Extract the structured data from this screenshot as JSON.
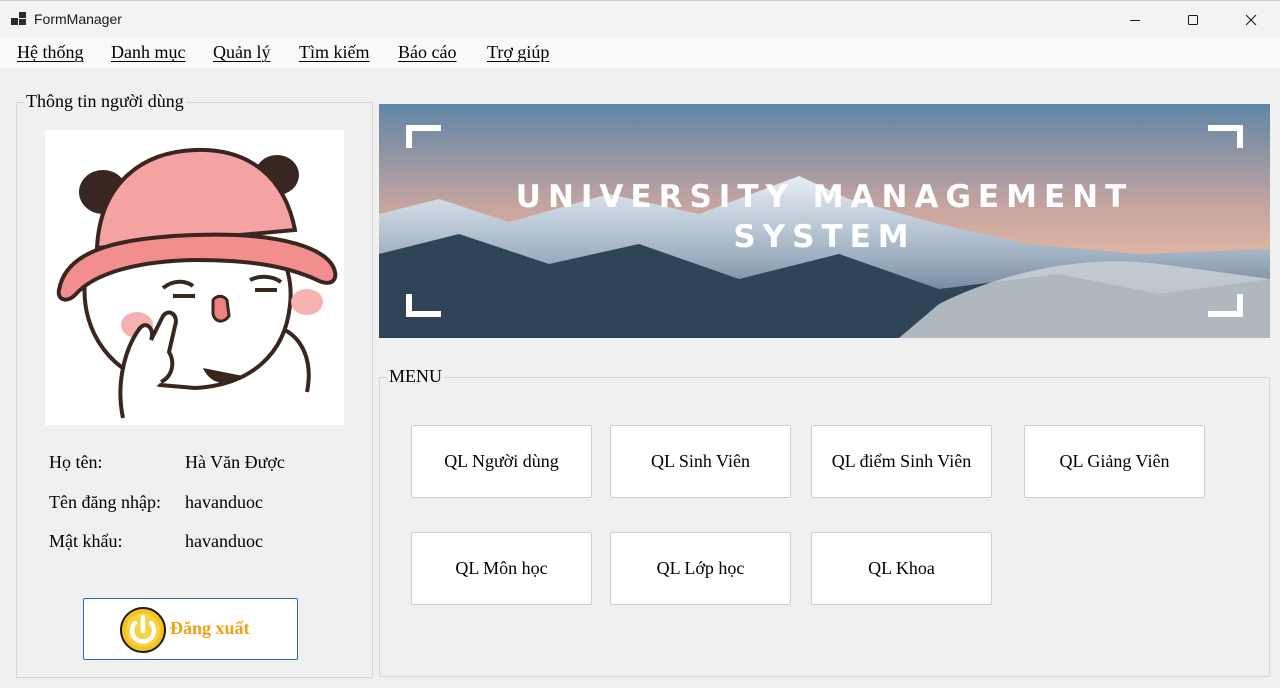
{
  "window": {
    "title": "FormManager",
    "icon": "app-windows-icon",
    "controls": [
      "minimize-icon",
      "maximize-icon",
      "close-icon"
    ]
  },
  "menubar": {
    "items": [
      {
        "label": "Hệ thống"
      },
      {
        "label": "Danh mục"
      },
      {
        "label": "Quản lý"
      },
      {
        "label": "Tìm kiếm"
      },
      {
        "label": "Báo cáo"
      },
      {
        "label": "Trợ giúp"
      }
    ]
  },
  "user_panel": {
    "legend": "Thông tin người dùng",
    "avatar_icon": "cartoon-avatar-pink-hat",
    "fields": [
      {
        "label": "Họ tên:",
        "value": "Hà Văn Được"
      },
      {
        "label": "Tên đăng nhập:",
        "value": "havanduoc"
      },
      {
        "label": "Mật khẩu:",
        "value": "havanduoc"
      }
    ],
    "logout": {
      "label": "Đăng xuất",
      "icon": "power-icon",
      "color": "#f0a010"
    }
  },
  "banner": {
    "line1": "UNIVERSITY MANAGEMENT",
    "line2": "SYSTEM"
  },
  "menu": {
    "legend": "MENU",
    "buttons": [
      {
        "label": "QL Người dùng"
      },
      {
        "label": "QL Sinh Viên"
      },
      {
        "label": "QL điểm Sinh Viên"
      },
      {
        "label": "QL Giảng Viên"
      },
      {
        "label": "QL Môn học"
      },
      {
        "label": "QL Lớp học"
      },
      {
        "label": "QL Khoa"
      }
    ]
  }
}
